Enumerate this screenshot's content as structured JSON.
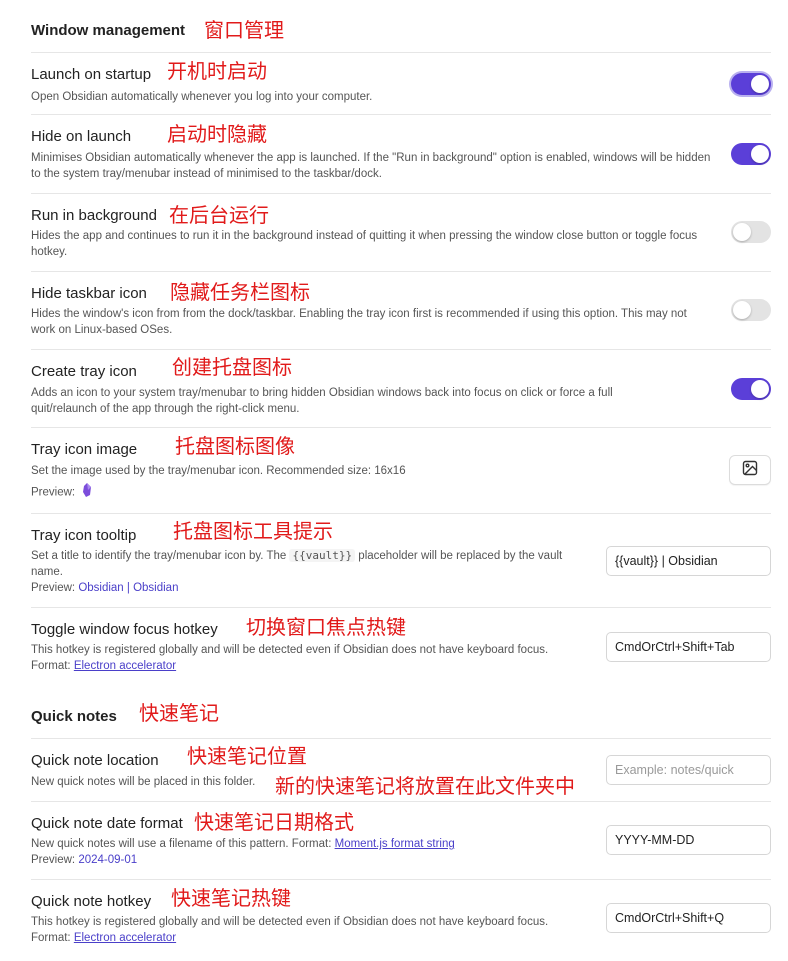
{
  "colors": {
    "accent": "#5b3fd8",
    "link": "#4a3fc9",
    "annotation": "#e11a1a"
  },
  "window": {
    "heading": "Window management",
    "annotation": "窗口管理",
    "launch_on_startup": {
      "title": "Launch on startup",
      "annotation": "开机时启动",
      "desc": "Open Obsidian automatically whenever you log into your computer.",
      "enabled": true
    },
    "hide_on_launch": {
      "title": "Hide on launch",
      "annotation": "启动时隐藏",
      "desc": "Minimises Obsidian automatically whenever the app is launched. If the \"Run in background\" option is enabled, windows will be hidden to the system tray/menubar instead of minimised to the taskbar/dock.",
      "enabled": true
    },
    "run_in_background": {
      "title": "Run in background",
      "annotation": "在后台运行",
      "desc": "Hides the app and continues to run it in the background instead of quitting it when pressing the window close button or toggle focus hotkey.",
      "enabled": false
    },
    "hide_taskbar_icon": {
      "title": "Hide taskbar icon",
      "annotation": "隐藏任务栏图标",
      "desc": "Hides the window's icon from from the dock/taskbar. Enabling the tray icon first is recommended if using this option. This may not work on Linux-based OSes.",
      "enabled": false
    },
    "create_tray_icon": {
      "title": "Create tray icon",
      "annotation": "创建托盘图标",
      "desc": "Adds an icon to your system tray/menubar to bring hidden Obsidian windows back into focus on click or force a full quit/relaunch of the app through the right-click menu.",
      "enabled": true
    },
    "tray_icon_image": {
      "title": "Tray icon image",
      "annotation": "托盘图标图像",
      "desc": "Set the image used by the tray/menubar icon. Recommended size: 16x16",
      "preview_label": "Preview:",
      "button_icon": "image-icon"
    },
    "tray_icon_tooltip": {
      "title": "Tray icon tooltip",
      "annotation": "托盘图标工具提示",
      "desc_before": "Set a title to identify the tray/menubar icon by. The",
      "placeholder_token": "{{vault}}",
      "desc_after": "placeholder will be replaced by the vault name.",
      "preview_label": "Preview:",
      "preview_value": "Obsidian | Obsidian",
      "value": "{{vault}} | Obsidian"
    },
    "toggle_focus_hotkey": {
      "title": "Toggle window focus hotkey",
      "annotation": "切换窗口焦点热键",
      "desc": "This hotkey is registered globally and will be detected even if Obsidian does not have keyboard focus.",
      "format_label": "Format:",
      "format_link": "Electron accelerator",
      "value": "CmdOrCtrl+Shift+Tab"
    }
  },
  "quick": {
    "heading": "Quick notes",
    "annotation": "快速笔记",
    "location": {
      "title": "Quick note location",
      "annotation": "快速笔记位置",
      "desc": "New quick notes will be placed in this folder.",
      "desc_annotation": "新的快速笔记将放置在此文件夹中",
      "placeholder": "Example: notes/quick"
    },
    "date_format": {
      "title": "Quick note date format",
      "annotation": "快速笔记日期格式",
      "desc": "New quick notes will use a filename of this pattern. Format:",
      "format_link": "Moment.js format string",
      "preview_label": "Preview:",
      "preview_value": "2024-09-01",
      "value": "YYYY-MM-DD"
    },
    "hotkey": {
      "title": "Quick note hotkey",
      "annotation": "快速笔记热键",
      "desc": "This hotkey is registered globally and will be detected even if Obsidian does not have keyboard focus.",
      "format_label": "Format:",
      "format_link": "Electron accelerator",
      "value": "CmdOrCtrl+Shift+Q"
    }
  }
}
